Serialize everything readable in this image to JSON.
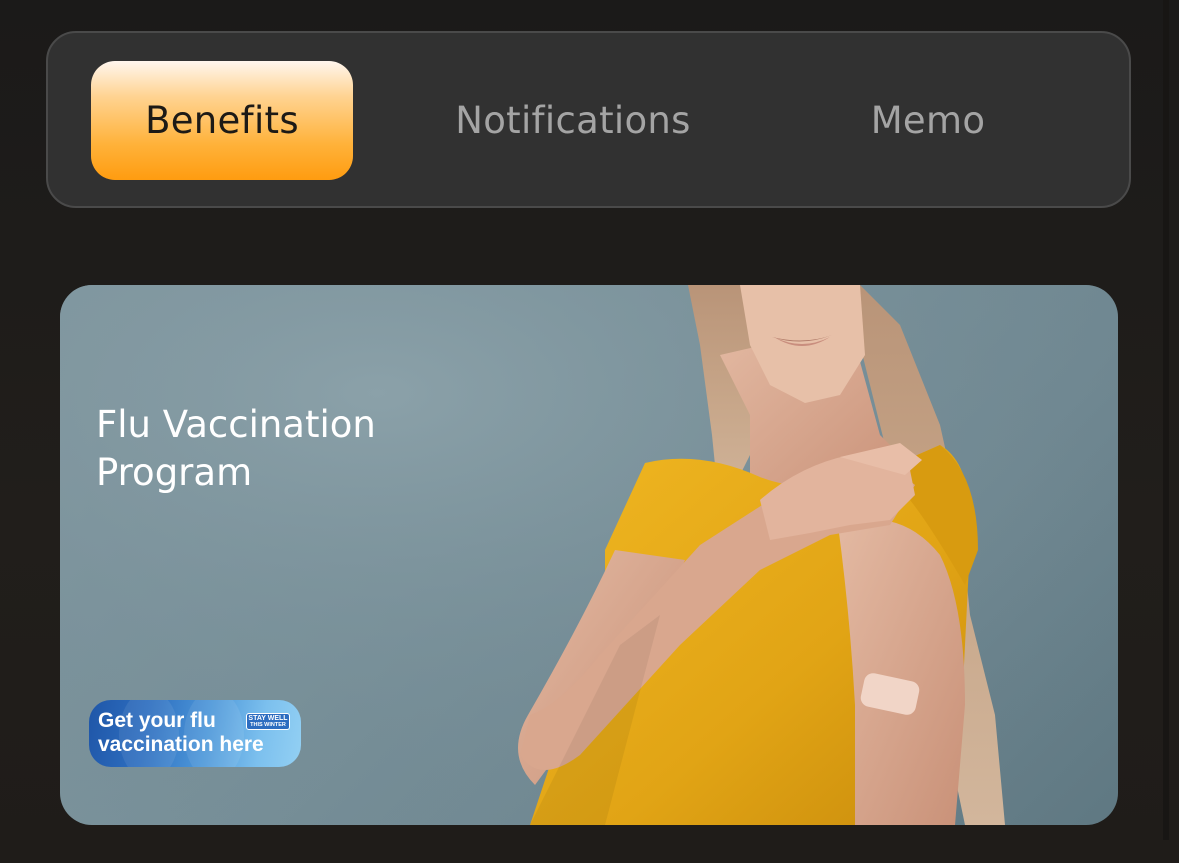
{
  "tabs": {
    "benefits": "Benefits",
    "notifications": "Notifications",
    "memo": "Memo",
    "selected": "Benefits"
  },
  "promo": {
    "title_line1": "Flu Vaccination",
    "title_line2": "Program",
    "badge_line1": "Get your flu",
    "badge_line2": "vaccination here",
    "badge_logo_line1": "STAY WELL",
    "badge_logo_line2": "THIS WINTER"
  },
  "colors": {
    "active_tab_top": "#fff6ee",
    "active_tab_bottom": "#ff9c10",
    "inactive_tab_text": "#a4a4a4",
    "card_background": "#7a929b",
    "shirt": "#e6ae1c"
  }
}
